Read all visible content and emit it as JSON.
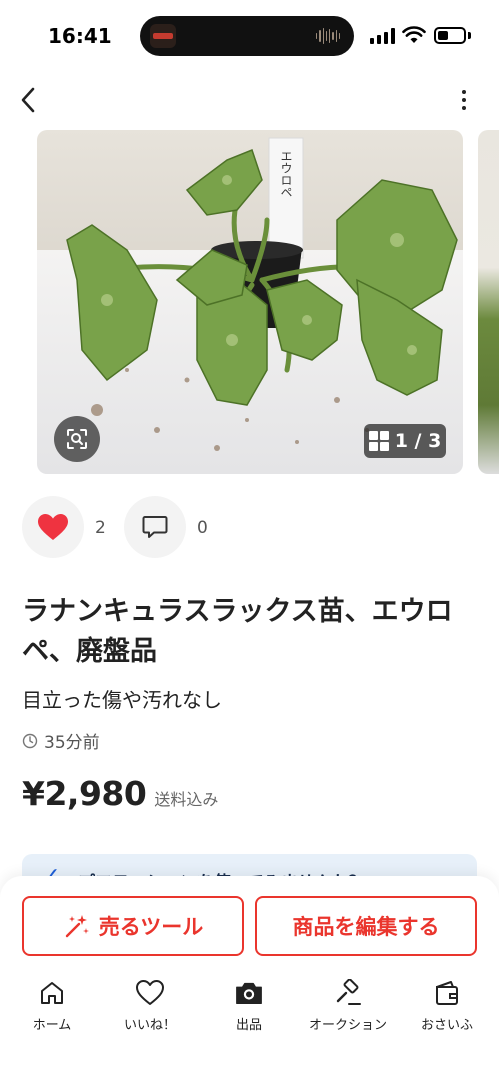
{
  "status_bar": {
    "time": "16:41"
  },
  "photo": {
    "counter": "1 / 3",
    "label_text": "エウロペ"
  },
  "actions": {
    "like_count": "2",
    "comment_count": "0"
  },
  "item": {
    "title": "ラナンキュラスラックス苗、エウロペ、廃盤品",
    "condition": "目立った傷や汚れなし",
    "posted": "35分前",
    "price": "¥2,980",
    "price_note": "送料込み"
  },
  "promo": {
    "text": "プロモーションを使ってみませんか？"
  },
  "buttons": {
    "sell_tools": "売るツール",
    "edit_item": "商品を編集する"
  },
  "tabs": [
    {
      "label": "ホーム",
      "icon": "home-icon"
    },
    {
      "label": "いいね！",
      "icon": "heart-outline-icon"
    },
    {
      "label": "出品",
      "icon": "camera-icon"
    },
    {
      "label": "オークション",
      "icon": "gavel-icon"
    },
    {
      "label": "おさいふ",
      "icon": "wallet-icon"
    }
  ],
  "colors": {
    "accent": "#ea352d",
    "heart": "#ef3340",
    "promo_bg": "#e7f0f9"
  }
}
